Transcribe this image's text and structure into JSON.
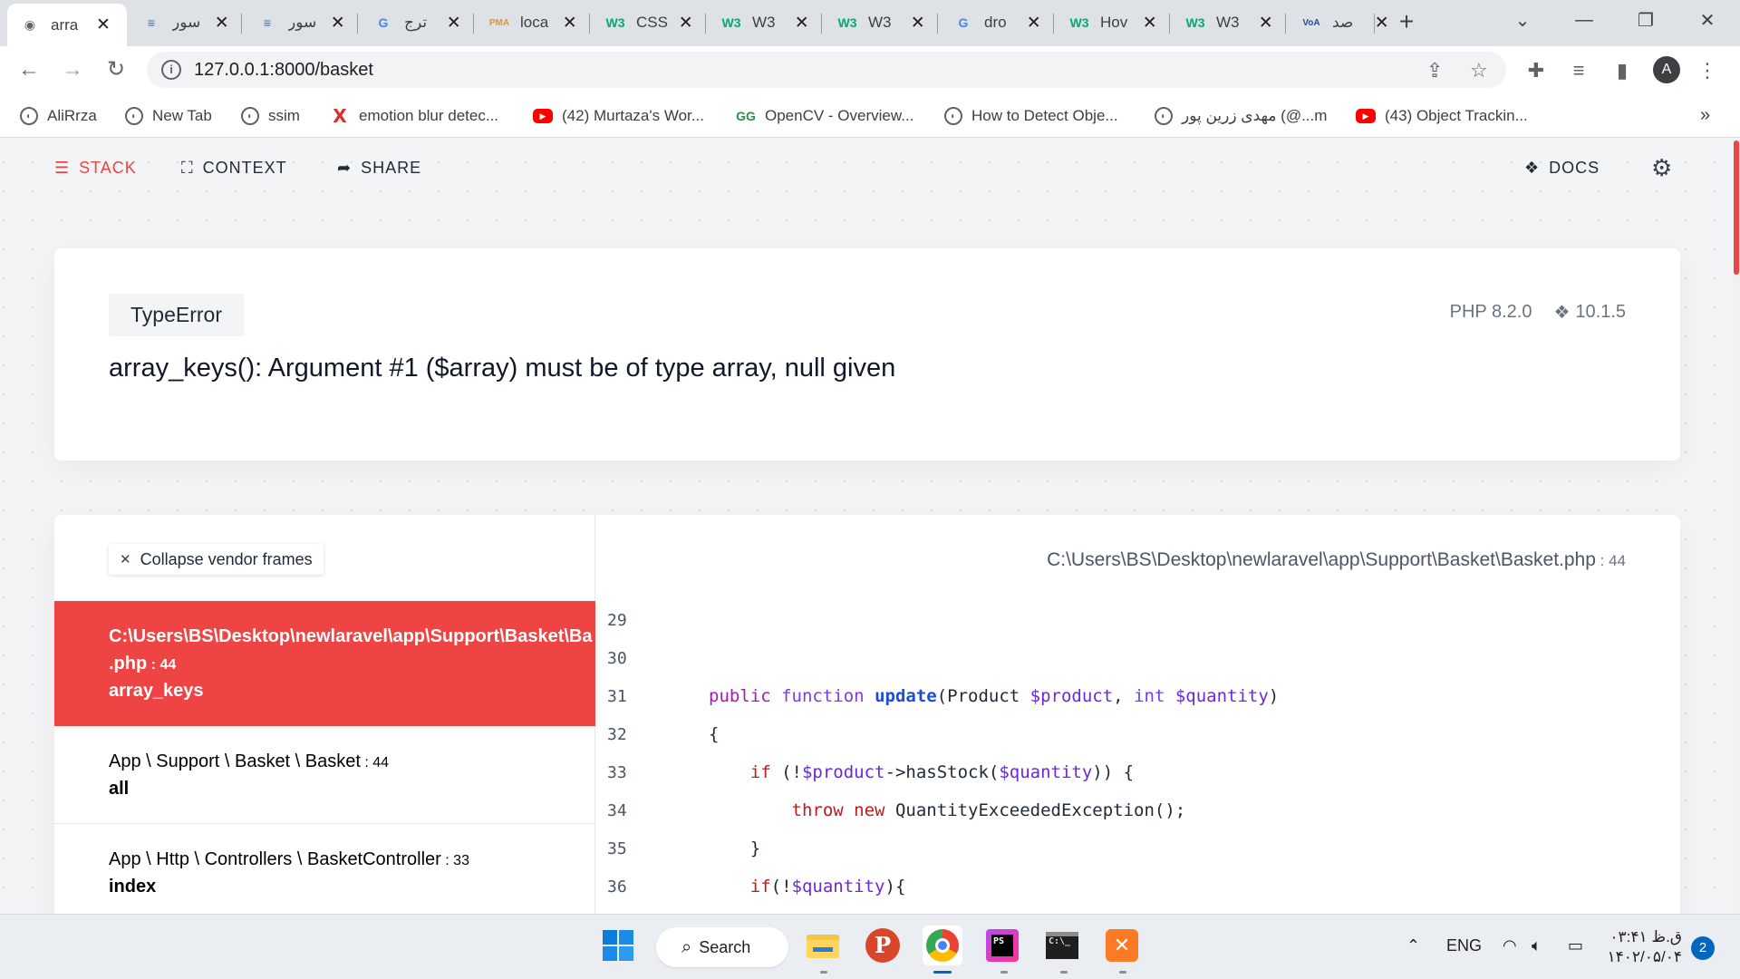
{
  "browser": {
    "tabs": [
      {
        "title": "arra",
        "fav": "◉",
        "favColor": "#5f6368",
        "active": true
      },
      {
        "title": "سور",
        "fav": "≡",
        "favColor": "#1a73e8"
      },
      {
        "title": "سور",
        "fav": "≡",
        "favColor": "#1a73e8"
      },
      {
        "title": "ترج",
        "fav": "G",
        "favColor": "#4285f4"
      },
      {
        "title": "loca",
        "fav": "PMA",
        "favColor": "#f29111"
      },
      {
        "title": "CSS",
        "fav": "W3",
        "favColor": "#04aa6d"
      },
      {
        "title": "W3",
        "fav": "W3",
        "favColor": "#04aa6d"
      },
      {
        "title": "W3",
        "fav": "W3",
        "favColor": "#04aa6d"
      },
      {
        "title": "dro",
        "fav": "G",
        "favColor": "#4285f4"
      },
      {
        "title": "Hov",
        "fav": "W3",
        "favColor": "#04aa6d"
      },
      {
        "title": "W3",
        "fav": "W3",
        "favColor": "#04aa6d"
      },
      {
        "title": "صد",
        "fav": "VoA",
        "favColor": "#1f4e9c"
      }
    ],
    "new_tab": "+",
    "window_controls": [
      "⌄",
      "—",
      "❐",
      "✕"
    ],
    "url": "127.0.0.1:8000/basket",
    "avatar_letter": "A",
    "bookmarks": [
      {
        "label": "AliRrza",
        "icon": "globe-icon",
        "kind": "globe"
      },
      {
        "label": "New Tab",
        "icon": "globe-icon",
        "kind": "globe"
      },
      {
        "label": "ssim",
        "icon": "globe-icon",
        "kind": "globe"
      },
      {
        "label": "emotion blur detec...",
        "icon": "x-brand-icon",
        "kind": "x"
      },
      {
        "label": "(42) Murtaza's Wor...",
        "icon": "youtube-icon",
        "kind": "yt"
      },
      {
        "label": "OpenCV - Overview...",
        "icon": "geeksforgeeks-icon",
        "kind": "gfg"
      },
      {
        "label": "How to Detect Obje...",
        "icon": "globe-icon",
        "kind": "globe"
      },
      {
        "label": "مهدی زرین پور (@...m",
        "icon": "globe-icon",
        "kind": "globe"
      },
      {
        "label": "(43) Object Trackin...",
        "icon": "youtube-icon",
        "kind": "yt"
      }
    ],
    "bookmarks_more": "»"
  },
  "ignition": {
    "nav": {
      "stack": "STACK",
      "context": "CONTEXT",
      "share": "SHARE",
      "docs": "DOCS"
    },
    "error": {
      "exception_class": "TypeError",
      "message": "array_keys(): Argument #1 ($array) must be of type array, null given",
      "php_version": "PHP 8.2.0",
      "laravel_version": "10.1.5"
    },
    "collapse_label": "Collapse vendor frames",
    "frames": [
      {
        "path": "C:\\Users\\BS\\Desktop\\newlaravel\\app\\Support\\Basket\\Ba",
        "path2": ".php",
        "line": "44",
        "fn": "array_keys",
        "active": true
      },
      {
        "path": "App \\ Support \\ Basket \\ Basket",
        "line": "44",
        "fn": "all",
        "active": false
      },
      {
        "path": "App \\ Http \\ Controllers \\ BasketController",
        "line": "33",
        "fn": "index",
        "active": false
      }
    ],
    "file": {
      "path": "C:\\Users\\BS\\Desktop\\newlaravel\\app\\Support\\Basket\\",
      "basename": "Basket",
      "ext": ".php",
      "line": "44"
    },
    "code": [
      {
        "n": "29",
        "html": ""
      },
      {
        "n": "30",
        "html": ""
      },
      {
        "n": "31",
        "html": "<span class=\"kw\">public</span> <span class=\"kw2\">function</span> <span class=\"fnm\">update</span>(Product <span class=\"var\">$product</span>, <span class=\"kw2\">int</span> <span class=\"var\">$quantity</span>)"
      },
      {
        "n": "32",
        "html": "{"
      },
      {
        "n": "33",
        "html": "    <span class=\"red\">if</span> (!<span class=\"var\">$product</span>-&gt;hasStock(<span class=\"var\">$quantity</span>)) {"
      },
      {
        "n": "34",
        "html": "        <span class=\"red\">throw</span> <span class=\"red\">new</span> QuantityExceededException();"
      },
      {
        "n": "35",
        "html": "    }"
      },
      {
        "n": "36",
        "html": "    <span class=\"red\">if</span>(!<span class=\"var\">$quantity</span>){"
      }
    ]
  },
  "taskbar": {
    "search_label": "Search",
    "lang": "ENG",
    "time": "۰۳:۴۱ ق.ظ",
    "date": "۱۴۰۲/۰۵/۰۴",
    "notification_count": "2"
  }
}
